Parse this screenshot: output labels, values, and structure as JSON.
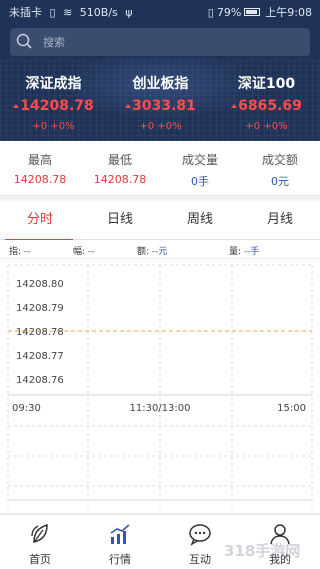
{
  "status_bar": {
    "carrier": "未插卡",
    "network_speed": "510B/s",
    "battery": "79%",
    "time": "上午9:08"
  },
  "search": {
    "placeholder": "搜索"
  },
  "indices": [
    {
      "name": "深证成指",
      "value": "14208.78",
      "change": "+0 +0%"
    },
    {
      "name": "创业板指",
      "value": "3033.81",
      "change": "+0 +0%"
    },
    {
      "name": "深证100",
      "value": "6865.69",
      "change": "+0 +0%"
    }
  ],
  "stats": [
    {
      "label": "最高",
      "value": "14208.78",
      "color": "#e03a3a"
    },
    {
      "label": "最低",
      "value": "14208.78",
      "color": "#e03a3a"
    },
    {
      "label": "成交量",
      "value": "0手",
      "color": "#2d58b0"
    },
    {
      "label": "成交额",
      "value": "0元",
      "color": "#2d58b0"
    }
  ],
  "tabs": [
    {
      "label": "分时",
      "active": true
    },
    {
      "label": "日线",
      "active": false
    },
    {
      "label": "周线",
      "active": false
    },
    {
      "label": "月线",
      "active": false
    }
  ],
  "info_bar": {
    "index_label": "指:",
    "index_value": "--",
    "range_label": "幅:",
    "range_value": "--",
    "amount_label": "额:",
    "amount_value": "--元",
    "volume_label": "量:",
    "volume_value": "--手"
  },
  "chart_data": {
    "type": "line",
    "y_ticks": [
      "14208.80",
      "14208.79",
      "14208.78",
      "14208.77",
      "14208.76"
    ],
    "x_ticks": [
      "09:30",
      "11:30/13:00",
      "15:00"
    ],
    "ylim": [
      14208.755,
      14208.805
    ],
    "reference_value": 14208.78,
    "series": []
  },
  "bottom_nav": [
    {
      "label": "首页",
      "icon": "home-leaf-icon"
    },
    {
      "label": "行情",
      "icon": "market-chart-icon"
    },
    {
      "label": "互动",
      "icon": "chat-bubble-icon"
    },
    {
      "label": "我的",
      "icon": "user-profile-icon"
    }
  ],
  "watermark": "318手游网",
  "colors": {
    "header_bg": "#1f3358",
    "up_red": "#ff4b4b",
    "tab_active": "#e03a3a",
    "blue_value": "#2d58b0",
    "reference_line": "#f0a050"
  }
}
